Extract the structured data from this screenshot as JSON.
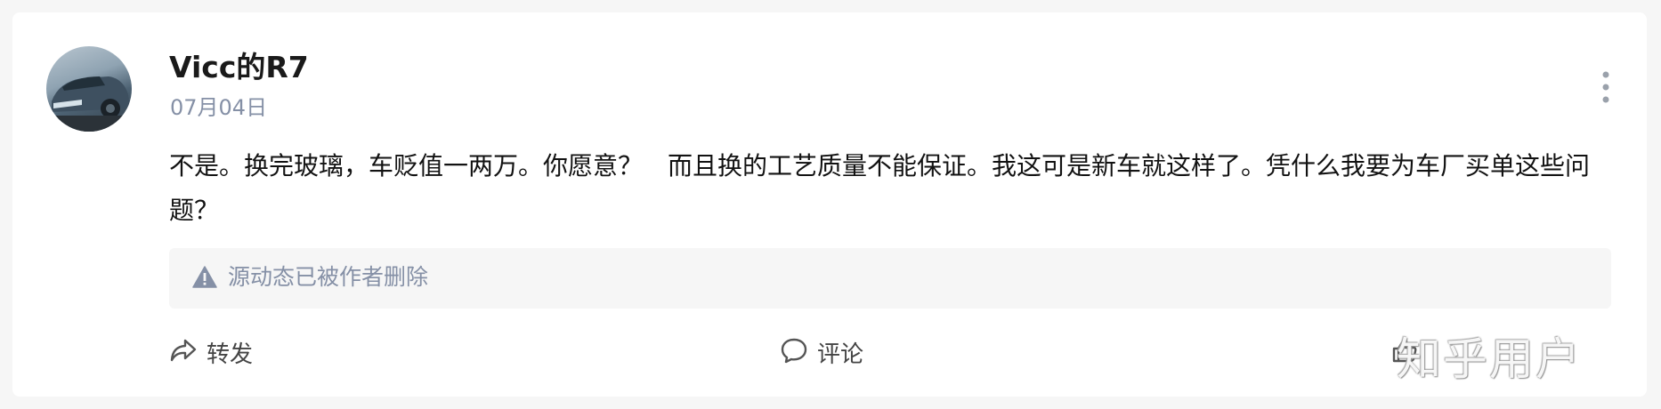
{
  "post": {
    "author": "Vicc的R7",
    "date": "07月04日",
    "content": "不是。换完玻璃，车贬值一两万。你愿意？　而且换的工艺质量不能保证。我这可是新车就这样了。凭什么我要为车厂买单这些问题？",
    "source_notice": "源动态已被作者删除"
  },
  "actions": {
    "repost": "转发",
    "comment": "评论"
  },
  "watermark": "知乎用户",
  "icons": {
    "more": "more-vertical-icon",
    "warning": "warning-icon",
    "repost": "repost-icon",
    "comment": "comment-icon",
    "like": "like-icon"
  }
}
